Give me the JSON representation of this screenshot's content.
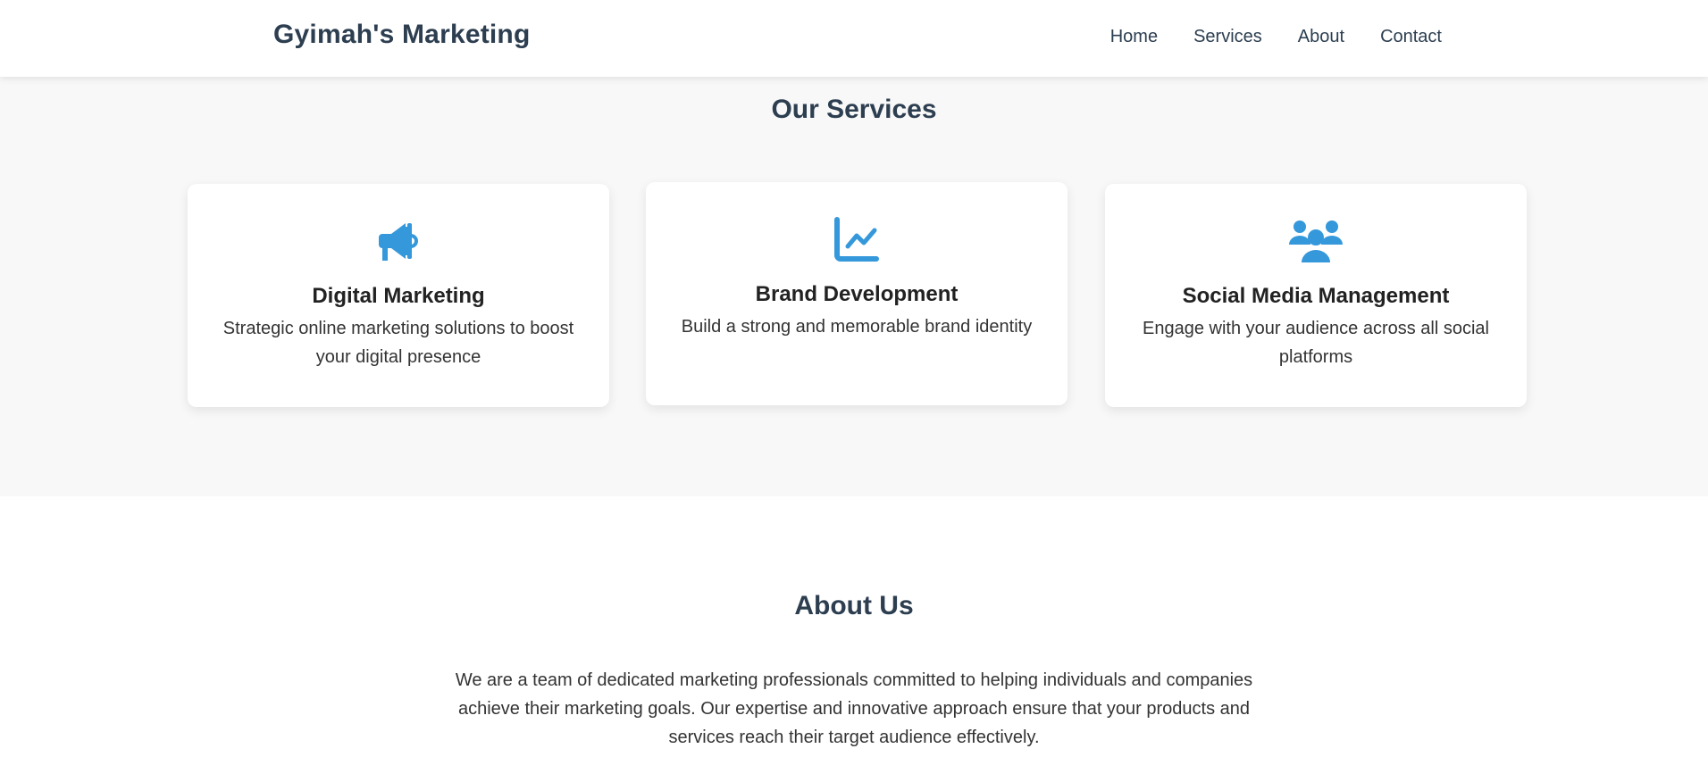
{
  "header": {
    "logo": "Gyimah's Marketing",
    "nav": [
      "Home",
      "Services",
      "About",
      "Contact"
    ]
  },
  "services": {
    "title": "Our Services",
    "cards": [
      {
        "icon": "megaphone-icon",
        "title": "Digital Marketing",
        "text": "Strategic online marketing solutions to boost your digital presence"
      },
      {
        "icon": "chart-line-icon",
        "title": "Brand Development",
        "text": "Build a strong and memorable brand identity"
      },
      {
        "icon": "users-icon",
        "title": "Social Media Management",
        "text": "Engage with your audience across all social platforms"
      }
    ]
  },
  "about": {
    "title": "About Us",
    "text": "We are a team of dedicated marketing professionals committed to helping individuals and companies achieve their marketing goals. Our expertise and innovative approach ensure that your products and services reach their target audience effectively."
  },
  "colors": {
    "accent": "#3498db",
    "heading": "#2c3e50",
    "section_bg": "#f8f8f8"
  }
}
